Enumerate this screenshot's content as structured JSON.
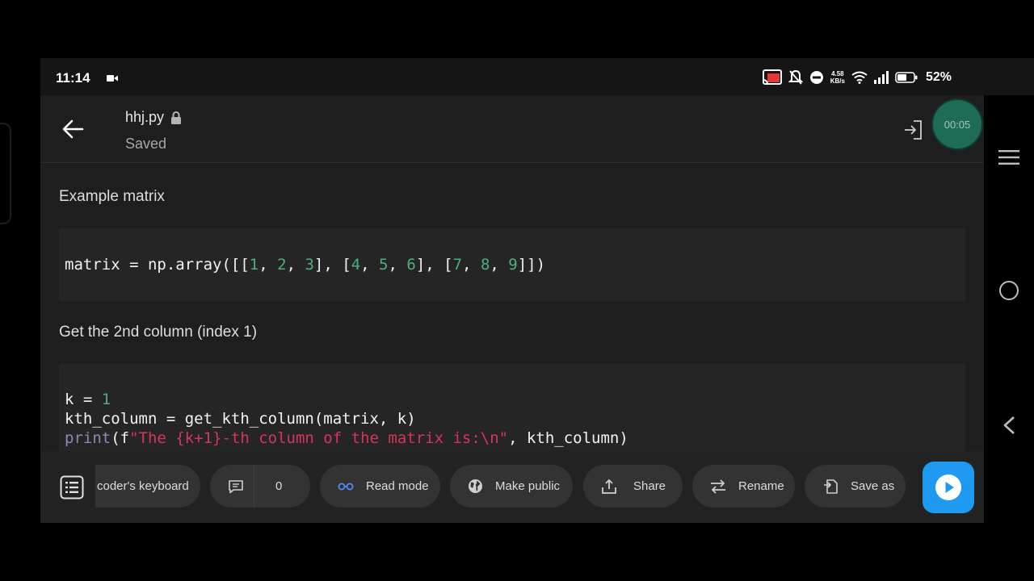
{
  "status": {
    "time": "11:14",
    "net_speed_value": "4.58",
    "net_speed_unit": "KB/s",
    "battery": "52%"
  },
  "header": {
    "filename": "hhj.py",
    "save_status": "Saved",
    "timer": "00:05"
  },
  "content": {
    "heading1": "Example matrix",
    "heading2": "Get the 2nd column (index 1)"
  },
  "toolbar": {
    "keyboard_label": "coder's keyboard",
    "comments_count": "0",
    "read_mode_label": "Read mode",
    "make_public_label": "Make public",
    "share_label": "Share",
    "rename_label": "Rename",
    "save_as_label": "Save as"
  },
  "colors": {
    "accent_blue": "#1e9bf0",
    "timer_green": "#1e6b56",
    "code_number": "#4fae7f",
    "code_string": "#d5355d"
  },
  "icons": [
    "back-arrow-icon",
    "lock-icon",
    "exit-icon",
    "menu-icon",
    "home-icon",
    "nav-back-icon",
    "list-icon",
    "comment-icon",
    "glasses-icon",
    "globe-icon",
    "share-icon",
    "swap-icon",
    "save-as-icon",
    "play-icon"
  ]
}
